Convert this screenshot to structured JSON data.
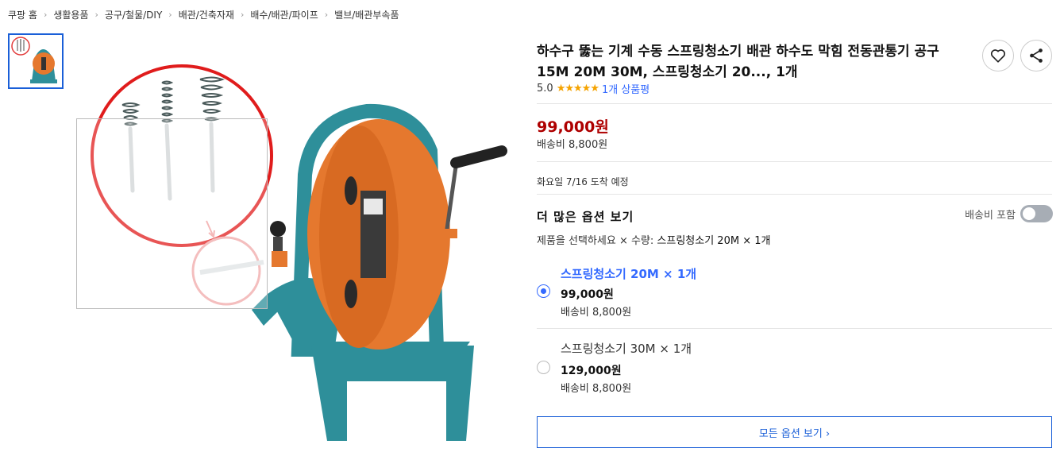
{
  "breadcrumb": {
    "items": [
      "쿠팡 홈",
      "생활용품",
      "공구/철물/DIY",
      "배관/건축자재",
      "배수/배관/파이프",
      "밸브/배관부속품"
    ],
    "separator": "›"
  },
  "product": {
    "title": "하수구 뚫는 기계 수동 스프링청소기 배관 하수도 막힘 전동관통기 공구 15M 20M 30M, 스프링청소기 20..., 1개",
    "rating_score": "5.0",
    "rating_stars": 5,
    "review_link": "1개 상품평",
    "price": "99,000원",
    "shipping": "배송비 8,800원",
    "delivery": "화요일 7/16 도착 예정"
  },
  "options": {
    "heading": "더 많은 옵션 보기",
    "shipping_toggle_label": "배송비 포함",
    "shipping_toggle_on": false,
    "select_hint_prefix": "제품을 선택하세요 × 수량: ",
    "select_hint_value": "스프링청소기 20M × 1개",
    "items": [
      {
        "name": "스프링청소기 20M × 1개",
        "price": "99,000원",
        "shipping": "배송비 8,800원",
        "selected": true
      },
      {
        "name": "스프링청소기 30M × 1개",
        "price": "129,000원",
        "shipping": "배송비 8,800원",
        "selected": false
      }
    ],
    "all_options_button": "모든 옵션 보기 ›"
  },
  "colors": {
    "accent_blue": "#346aff",
    "price_red": "#ae0000",
    "star": "#f5a300",
    "machine_teal": "#2e8f9a",
    "drum_orange": "#e5782e"
  }
}
